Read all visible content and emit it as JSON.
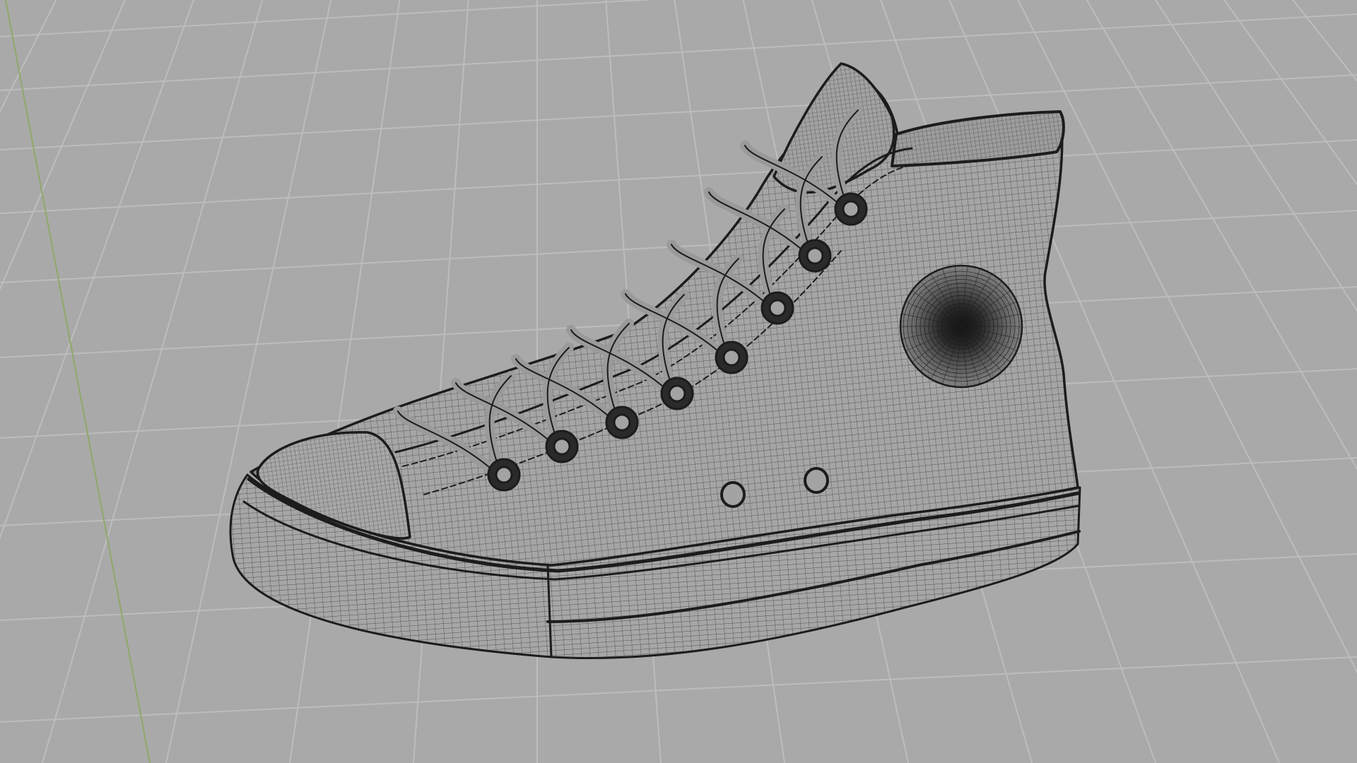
{
  "viewport": {
    "view_mode": "wireframe",
    "background_color": "#a9a9a9",
    "grid_visible": true,
    "grid_line_color": "#bdbdbd",
    "y_axis_color": "#8fa86a",
    "wire_color": "#1c1c1c",
    "model_fill_color": "#a3a3a3",
    "model_name_icon": "high-top-sneaker-wireframe"
  }
}
